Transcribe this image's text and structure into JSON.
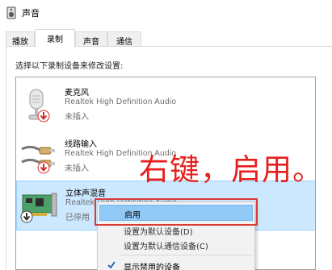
{
  "window": {
    "title": "声音"
  },
  "tabs": [
    {
      "label": "播放"
    },
    {
      "label": "录制"
    },
    {
      "label": "声音"
    },
    {
      "label": "通信"
    }
  ],
  "instruction": "选择以下录制设备来修改设置:",
  "devices": [
    {
      "name": "麦克风",
      "driver": "Realtek High Definition Audio",
      "status": "未插入"
    },
    {
      "name": "线路输入",
      "driver": "Realtek High Definition Audio",
      "status": "未插入"
    },
    {
      "name": "立体声混音",
      "driver": "Realtek High Definition Audio",
      "status": "已停用"
    }
  ],
  "annotation": "右键，启用。",
  "context_menu": {
    "items": [
      {
        "label": "启用"
      },
      {
        "label": "设置为默认设备(D)"
      },
      {
        "label": "设置为默认通信设备(C)"
      },
      {
        "label": "显示禁用的设备"
      }
    ]
  },
  "colors": {
    "selection": "#cce8ff",
    "menu_hover": "#91c9f7",
    "annotation_red": "#e61e1e",
    "disabled_arrow": "#d92b2b"
  }
}
